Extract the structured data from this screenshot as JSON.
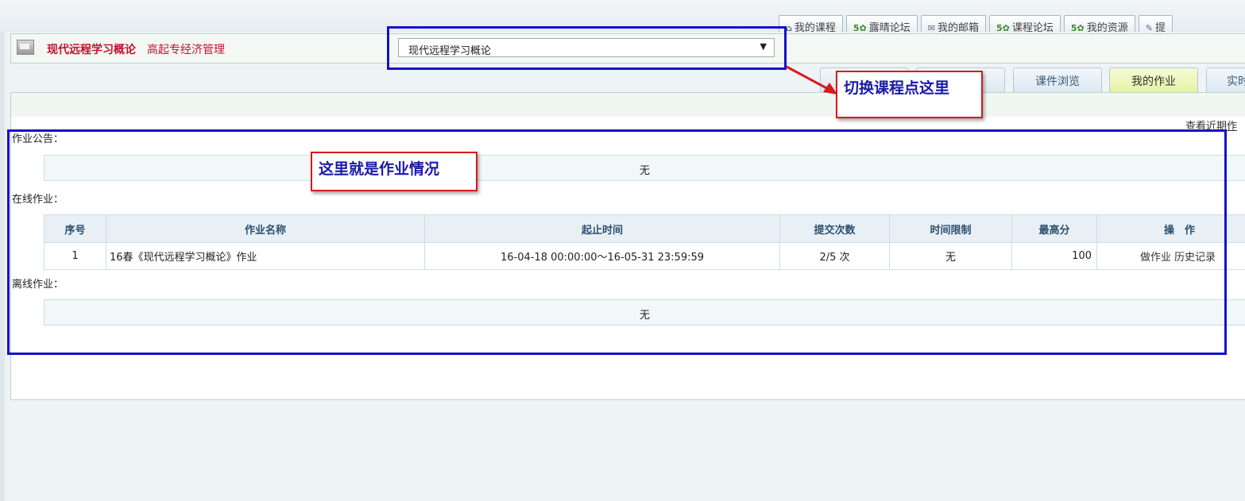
{
  "top_links": [
    {
      "icon": "home-icon",
      "label": "我的课程"
    },
    {
      "icon": "bbs-icon",
      "label": "露晴论坛"
    },
    {
      "icon": "mail-icon",
      "label": "我的邮箱"
    },
    {
      "icon": "bbs-icon",
      "label": "课程论坛"
    },
    {
      "icon": "bbs-icon",
      "label": "我的资源"
    },
    {
      "icon": "pen-icon",
      "label": "提"
    }
  ],
  "course_bar": {
    "title": "现代远程学习概论",
    "major": "高起专经济管理",
    "select_value": "现代远程学习概论",
    "select_arrow": "▼"
  },
  "tabs": [
    {
      "label": "",
      "active": false
    },
    {
      "label": "",
      "active": false
    },
    {
      "label": "课件浏览",
      "active": false
    },
    {
      "label": "我的作业",
      "active": true
    },
    {
      "label": "实时",
      "active": false
    }
  ],
  "recent_link": "查看近期作",
  "sections": {
    "notice_label": "作业公告：",
    "notice_value": "无",
    "online_label": "在线作业：",
    "offline_label": "离线作业：",
    "offline_value": "无"
  },
  "online_table": {
    "headers": [
      "序号",
      "作业名称",
      "起止时间",
      "提交次数",
      "时间限制",
      "最高分",
      "操　作"
    ],
    "rows": [
      {
        "no": "1",
        "name": "16春《现代远程学习概论》作业",
        "period": "16-04-18 00:00:00～16-05-31 23:59:59",
        "submits": "2/5 次",
        "time_limit": "无",
        "max_score": "100",
        "op_do": "做作业",
        "op_history": "历史记录"
      }
    ]
  },
  "annotations": {
    "switch_course": "切换课程点这里",
    "homework_here": "这里就是作业情况"
  },
  "colors": {
    "annotation_box": "#1510c9",
    "callout_border": "#d8191d",
    "course_title": "#c8102e",
    "active_tab": "#e4f2a8"
  }
}
